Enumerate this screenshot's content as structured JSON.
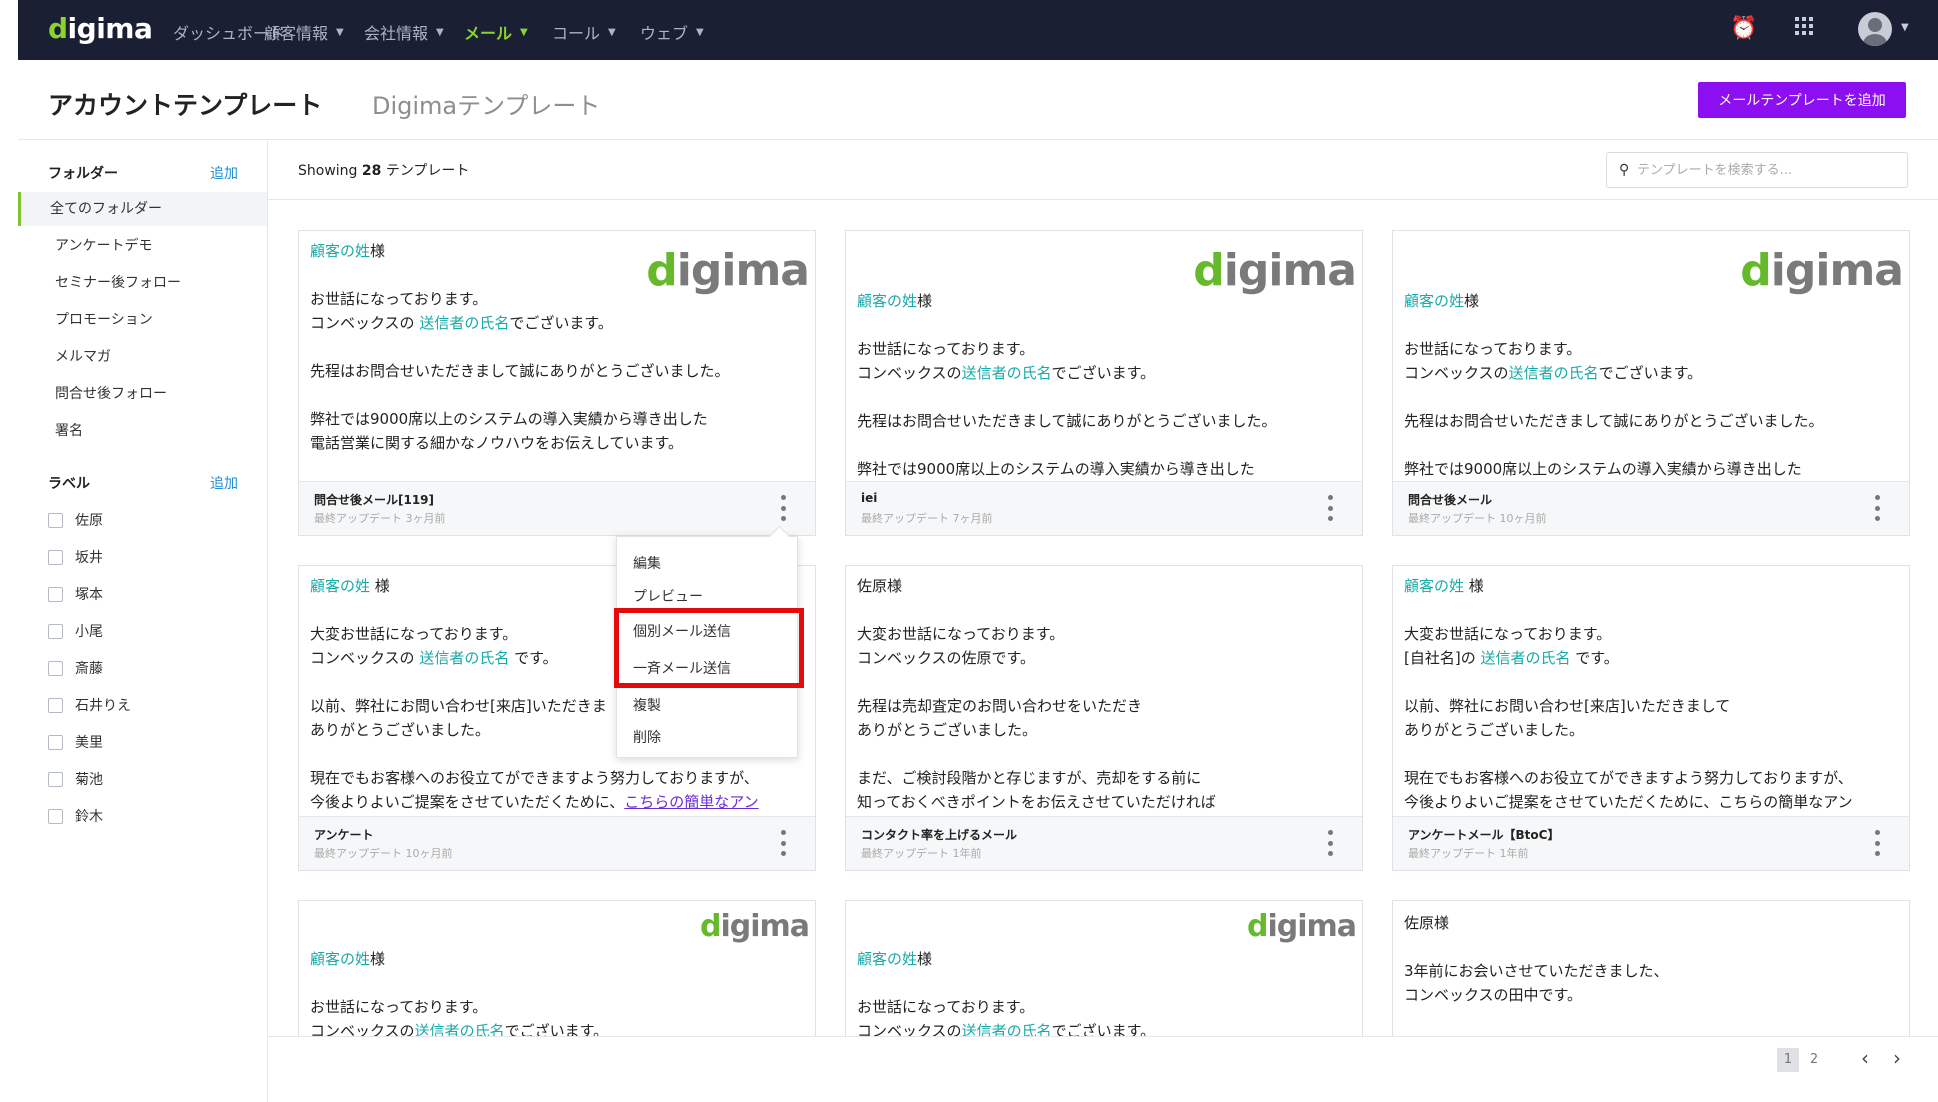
{
  "nav": {
    "logo": "digima",
    "items": [
      {
        "label": "ダッシュボード"
      },
      {
        "label": "顧客情報"
      },
      {
        "label": "会社情報"
      },
      {
        "label": "メール"
      },
      {
        "label": "コール"
      },
      {
        "label": "ウェブ"
      }
    ]
  },
  "header": {
    "title": "アカウントテンプレート",
    "tab_digima": "Digimaテンプレート",
    "add_button": "メールテンプレートを追加"
  },
  "sidebar": {
    "folders_heading": "フォルダー",
    "folders_add": "追加",
    "folders": [
      {
        "label": "全てのフォルダー"
      },
      {
        "label": "アンケートデモ"
      },
      {
        "label": "セミナー後フォロー"
      },
      {
        "label": "プロモーション"
      },
      {
        "label": "メルマガ"
      },
      {
        "label": "問合せ後フォロー"
      },
      {
        "label": "署名"
      }
    ],
    "labels_heading": "ラベル",
    "labels_add": "追加",
    "labels": [
      {
        "label": "佐原"
      },
      {
        "label": "坂井"
      },
      {
        "label": "塚本"
      },
      {
        "label": "小尾"
      },
      {
        "label": "斎藤"
      },
      {
        "label": "石井りえ"
      },
      {
        "label": "美里"
      },
      {
        "label": "菊池"
      },
      {
        "label": "鈴木"
      }
    ]
  },
  "main": {
    "showing_prefix": "Showing",
    "showing_count": "28",
    "showing_suffix": "テンプレート",
    "search_placeholder": "テンプレートを検索する..."
  },
  "cards": [
    {
      "logo": "digima",
      "greeting_hl": "顧客の姓",
      "greeting_tail": "様",
      "l1": "お世話になっております。",
      "l2_pre": "コンベックスの ",
      "l2_hl": "送信者の氏名",
      "l2_post": "でございます。",
      "l3": "先程はお問合せいただきまして誠にありがとうございました。",
      "l4": "弊社では9000席以上のシステムの導入実績から導き出した",
      "l5": "電話営業に関する細かなノウハウをお伝えしています。",
      "name": "問合せ後メール[119]",
      "updated": "最終アップデート 3ヶ月前"
    },
    {
      "logo": "digima",
      "greeting_hl": "顧客の姓",
      "greeting_tail": "様",
      "l1": "お世話になっております。",
      "l2_pre": "コンベックスの",
      "l2_hl": "送信者の氏名",
      "l2_post": "でございます。",
      "l3": "先程はお問合せいただきまして誠にありがとうございました。",
      "l4": "弊社では9000席以上のシステムの導入実績から導き出した",
      "name": "iei",
      "updated": "最終アップデート 7ヶ月前"
    },
    {
      "logo": "digima",
      "greeting_hl": "顧客の姓",
      "greeting_tail": "様",
      "l1": "お世話になっております。",
      "l2_pre": "コンベックスの",
      "l2_hl": "送信者の氏名",
      "l2_post": "でございます。",
      "l3": "先程はお問合せいただきまして誠にありがとうございました。",
      "l4": "弊社では9000席以上のシステムの導入実績から導き出した",
      "name": "問合せ後メール",
      "updated": "最終アップデート 10ヶ月前"
    },
    {
      "greeting_hl": "顧客の姓",
      "greeting_tail": " 様",
      "l1": "大変お世話になっております。",
      "l2_pre": "コンベックスの ",
      "l2_hl": "送信者の氏名",
      "l2_post": " です。",
      "l3": "以前、弊社にお問い合わせ[来店]いただきま",
      "l4": "ありがとうございました。",
      "l5": "現在でもお客様へのお役立てができますよう努力しておりますが、",
      "l6_pre": "今後よりよいご提案をさせていただくために、",
      "l6_link": "こちらの簡単なアン",
      "name": "アンケート",
      "updated": "最終アップデート 10ヶ月前"
    },
    {
      "greeting": "佐原様",
      "l1": "大変お世話になっております。",
      "l2": "コンベックスの佐原です。",
      "l3": "先程は売却査定のお問い合わせをいただき",
      "l4": "ありがとうございました。",
      "l5": "まだ、ご検討段階かと存じますが、売却をする前に",
      "l6": "知っておくべきポイントをお伝えさせていただければ",
      "name": "コンタクト率を上げるメール",
      "updated": "最終アップデート 1年前"
    },
    {
      "greeting_hl": "顧客の姓",
      "greeting_tail": " 様",
      "l1": "大変お世話になっております。",
      "l2_pre": "[自社名]の ",
      "l2_hl": "送信者の氏名",
      "l2_post": " です。",
      "l3": "以前、弊社にお問い合わせ[来店]いただきまして",
      "l4": "ありがとうございました。",
      "l5": "現在でもお客様へのお役立てができますよう努力しておりますが、",
      "l6": "今後よりよいご提案をさせていただくために、こちらの簡単なアン",
      "name": "アンケートメール【BtoC】",
      "updated": "最終アップデート 1年前"
    },
    {
      "logo": "digima",
      "greeting_hl": "顧客の姓",
      "greeting_tail": "様",
      "l1": "お世話になっております。",
      "l2_pre": "コンベックスの",
      "l2_hl": "送信者の氏名",
      "l2_post": "でございます。"
    },
    {
      "logo": "digima",
      "greeting_hl": "顧客の姓",
      "greeting_tail": "様",
      "l1": "お世話になっております。",
      "l2_pre": "コンベックスの",
      "l2_hl": "送信者の氏名",
      "l2_post": "でございます。"
    },
    {
      "greeting": "佐原様",
      "l1": "3年前にお会いさせていただきました、",
      "l2": "コンベックスの田中です。"
    }
  ],
  "dropdown": {
    "items": [
      {
        "label": "編集"
      },
      {
        "label": "プレビュー"
      },
      {
        "label": "個別メール送信"
      },
      {
        "label": "一斉メール送信"
      },
      {
        "label": "複製"
      },
      {
        "label": "削除"
      }
    ]
  },
  "pagination": {
    "pages": [
      "1",
      "2"
    ],
    "prev": "‹",
    "next": "›"
  },
  "colors": {
    "accent_purple": "#8b0ff0",
    "brand_green": "#8bd331",
    "highlight_teal": "#19a9a8",
    "nav_bg": "#1b1f33",
    "annotation_red": "#e30b0b"
  }
}
